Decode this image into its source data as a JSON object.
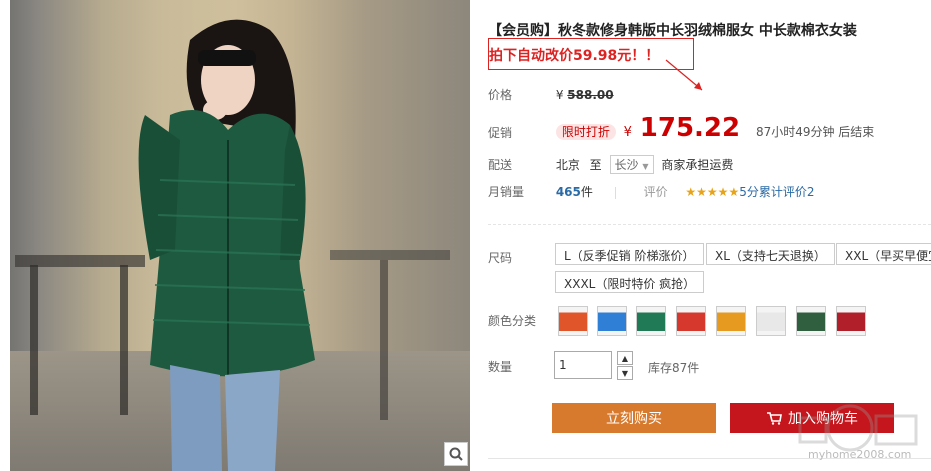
{
  "product": {
    "title": "【会员购】秋冬款修身韩版中长羽绒棉服女 中长款棉衣女装",
    "promo_note": "拍下自动改价59.98元！！",
    "original_price_label": "价格",
    "original_price_currency": "¥",
    "original_price": "588.00",
    "sale_price_label": "促销",
    "sale_tag": "限时打折",
    "sale_currency": "¥",
    "sale_price": "175.22",
    "countdown": "87小时49分钟 后结束",
    "shipping_label": "配送",
    "ship_from": "北京",
    "ship_to_word": "至",
    "ship_to": "长沙",
    "shipping_note": "商家承担运费",
    "monthly_sales_label": "月销量",
    "monthly_sales": "465",
    "monthly_sales_unit": "件",
    "rating_label": "评价",
    "rating_stars": "★★★★★",
    "rating_text": "5分累计评价2",
    "accent_color": "#c4161c",
    "buy_color": "#d87a2e"
  },
  "options": {
    "size_label": "尺码",
    "sizes": [
      "L（反季促销 阶梯涨价）",
      "XL（支持七天退换）",
      "XXL（早买早便宜",
      "XXXL（限时特价 疯抢）"
    ],
    "color_label": "颜色分类",
    "colors": [
      "#e0552a",
      "#2f7fd6",
      "#1f7a55",
      "#d6382e",
      "#e69a1f",
      "#e8e8e8",
      "#2f5f3f",
      "#b01f2a"
    ],
    "quantity_label": "数量",
    "quantity_value": "1",
    "stock": "库存87件"
  },
  "actions": {
    "buy_now": "立刻购买",
    "add_to_cart": "加入购物车"
  },
  "watermark": {
    "text": "myhome2008.com"
  }
}
